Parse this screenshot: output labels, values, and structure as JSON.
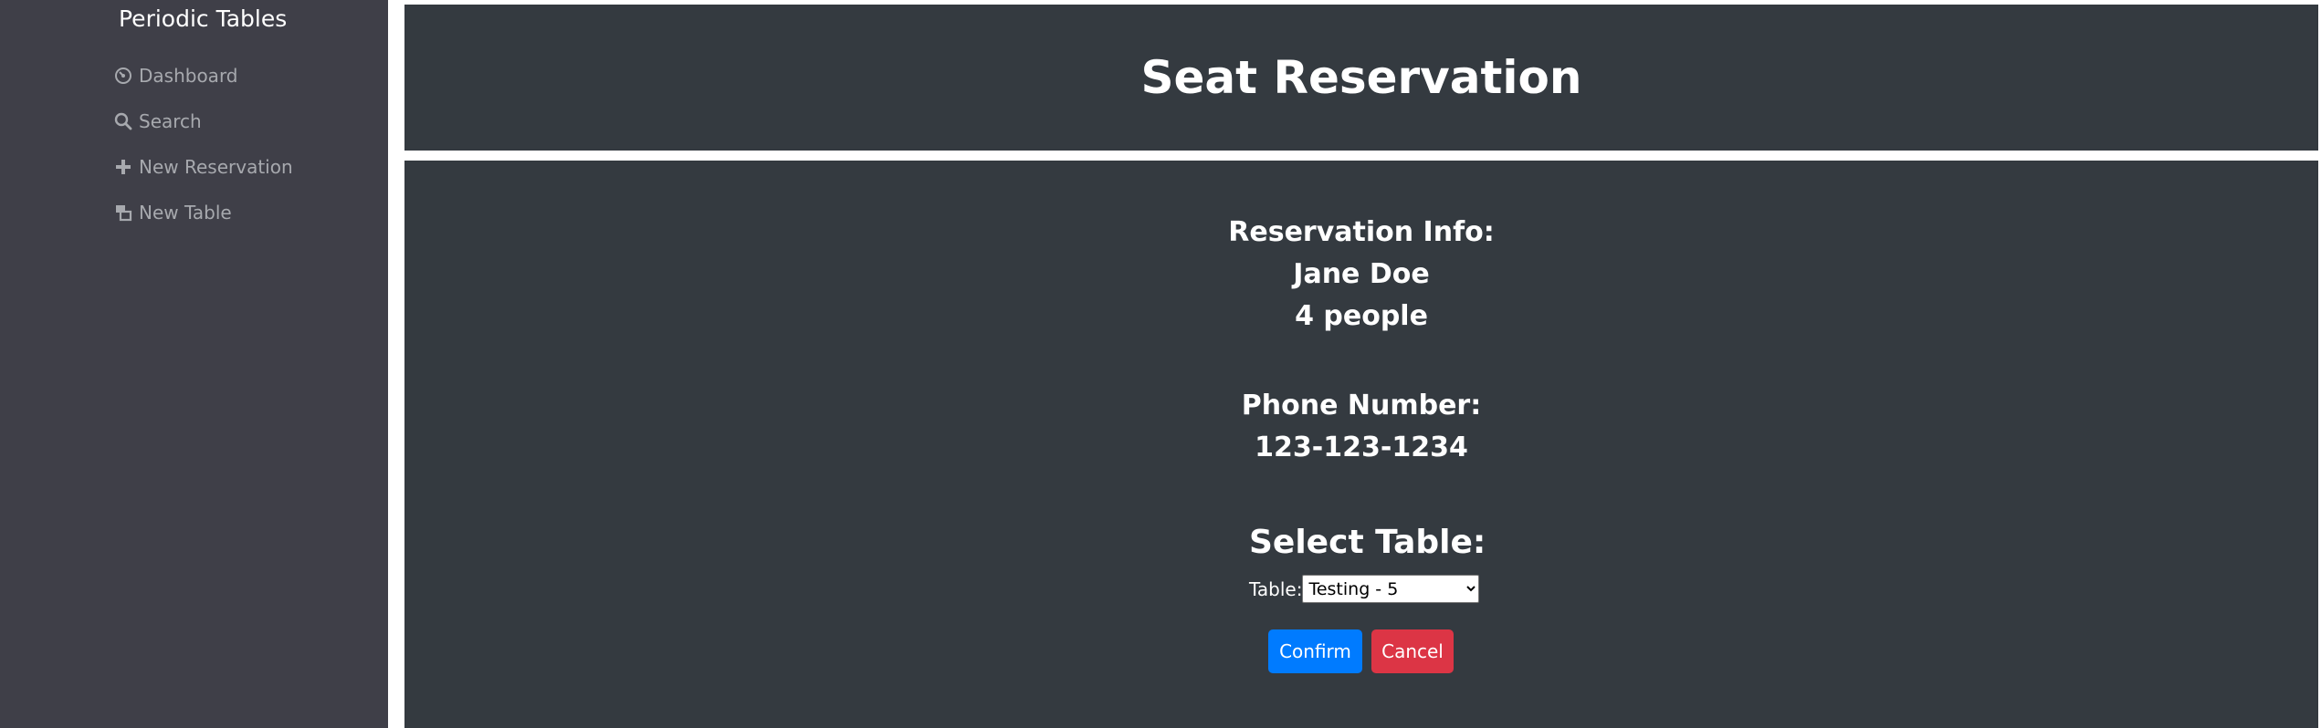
{
  "sidebar": {
    "brand": "Periodic Tables",
    "items": [
      {
        "label": "Dashboard",
        "icon": "dashboard-icon"
      },
      {
        "label": "Search",
        "icon": "search-icon"
      },
      {
        "label": "New Reservation",
        "icon": "plus-icon"
      },
      {
        "label": "New Table",
        "icon": "tables-icon"
      }
    ]
  },
  "header": {
    "title": "Seat Reservation"
  },
  "reservation": {
    "heading": "Reservation Info:",
    "name": "Jane Doe",
    "people": "4 people",
    "phone_heading": "Phone Number:",
    "phone": "123-123-1234"
  },
  "seat_form": {
    "title": "Select Table:",
    "table_label": "Table:",
    "selected_option": "Testing - 5",
    "confirm_label": "Confirm",
    "cancel_label": "Cancel"
  },
  "colors": {
    "sidebar_bg": "#3f3f48",
    "panel_bg": "#343a40",
    "confirm": "#007bff",
    "cancel": "#dc3545"
  }
}
